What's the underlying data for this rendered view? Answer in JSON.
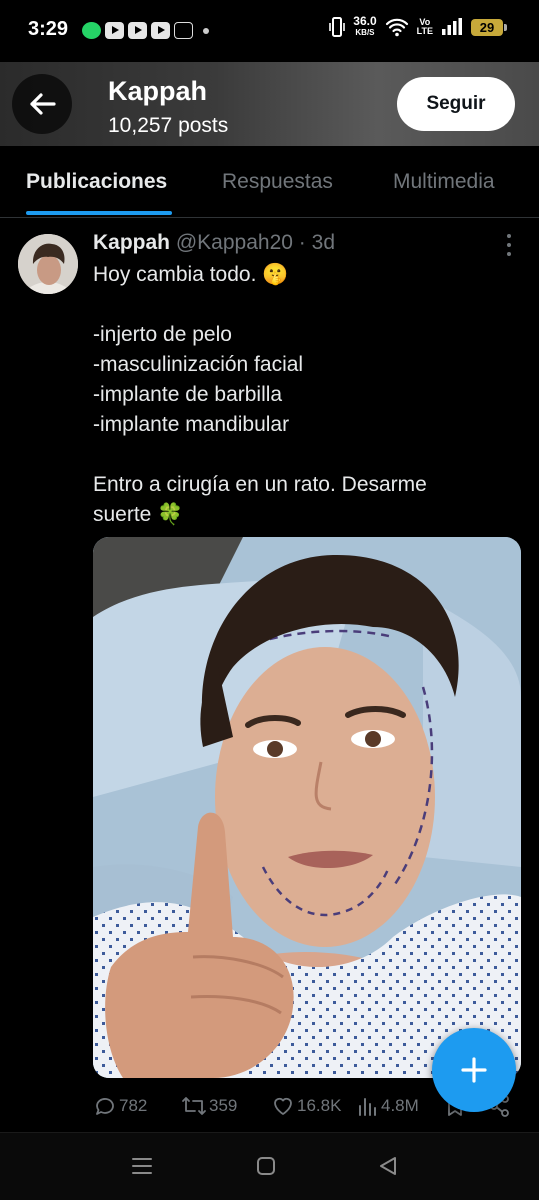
{
  "status_bar": {
    "time": "3:29",
    "speed": "36.0",
    "speed_unit": "KB/S",
    "lte_top": "Vo",
    "lte_bottom": "LTE",
    "battery": "29"
  },
  "header": {
    "name": "Kappah",
    "post_count": "10,257 posts",
    "follow_label": "Seguir"
  },
  "tabs": [
    {
      "label": "Publicaciones"
    },
    {
      "label": "Respuestas"
    },
    {
      "label": "Multimedia"
    }
  ],
  "post": {
    "author_name": "Kappah",
    "handle": "@Kappah20",
    "separator": "·",
    "time": "3d",
    "lines": [
      "Hoy cambia todo. 🤫",
      "",
      "-injerto de pelo",
      "-masculinización facial",
      "-implante de barbilla",
      "-implante mandibular",
      "",
      "Entro a cirugía en un rato. Desarme",
      "suerte 🍀"
    ],
    "stats": {
      "replies": "782",
      "reposts": "359",
      "likes": "16.8K",
      "views": "4.8M"
    }
  },
  "colors": {
    "accent": "#1d9bf0",
    "background": "#000000",
    "muted": "#71767b",
    "text": "#e7e9ea"
  }
}
